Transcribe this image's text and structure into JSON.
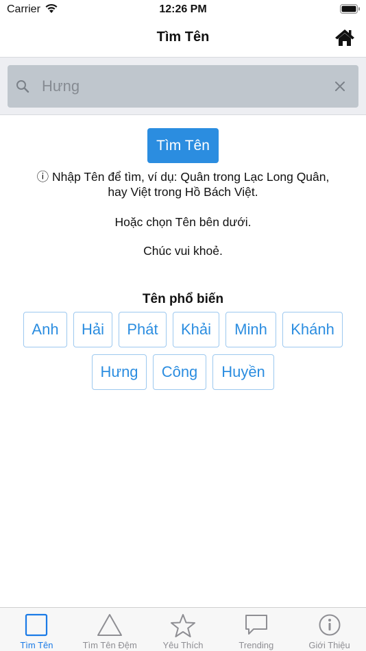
{
  "status_bar": {
    "carrier": "Carrier",
    "time": "12:26 PM"
  },
  "nav": {
    "title": "Tìm Tên",
    "home_icon": "home-icon"
  },
  "search": {
    "value": "",
    "placeholder": "Hưng"
  },
  "primary_button": {
    "label": "Tìm Tên"
  },
  "hints": {
    "line1": "ⓘ Nhập Tên để tìm, ví dụ: Quân trong Lạc Long Quân,",
    "line2": "hay Việt trong Hồ Bách Việt.",
    "line3": "Hoặc chọn Tên bên dưới.",
    "line4": "Chúc vui khoẻ."
  },
  "popular": {
    "title": "Tên phổ biến",
    "names": [
      "Anh",
      "Hải",
      "Phát",
      "Khải",
      "Minh",
      "Khánh",
      "Hưng",
      "Công",
      "Huyền"
    ]
  },
  "tabs": [
    {
      "label": "Tìm Tên",
      "icon": "square-icon",
      "active": true
    },
    {
      "label": "Tìm Tên Đệm",
      "icon": "triangle-icon",
      "active": false
    },
    {
      "label": "Yêu Thích",
      "icon": "star-icon",
      "active": false
    },
    {
      "label": "Trending",
      "icon": "chat-bubble-icon",
      "active": false
    },
    {
      "label": "Giới Thiệu",
      "icon": "info-icon",
      "active": false
    }
  ],
  "colors": {
    "accent": "#2b8de0",
    "tab_active": "#1a7ae6",
    "tab_inactive": "#8e8e93",
    "search_bg": "#bfc6cd"
  }
}
